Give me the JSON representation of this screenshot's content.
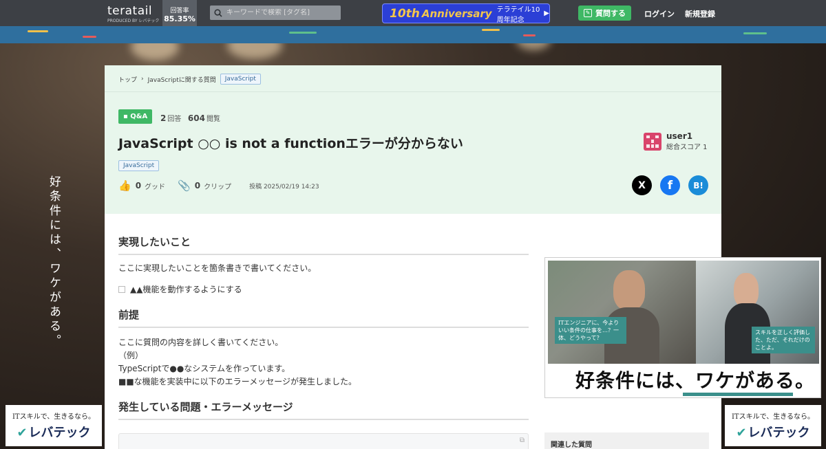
{
  "header": {
    "logo_name": "teratail",
    "logo_sub": "PRODUCED BY レバテック",
    "answer_rate_label": "回答率",
    "answer_rate_value": "85.35%",
    "search_placeholder": "キーワードで検索 [タグ名]",
    "anniversary_num": "10th",
    "anniversary_word": "Anniversary",
    "anniversary_jp": "テラテイル10周年記念",
    "ask_label": "質問する",
    "login_label": "ログイン",
    "signup_label": "新規登録",
    "bg_color": "#3d4045",
    "accent_green": "#3fb865"
  },
  "side_ads": {
    "copy": "好条件には、ワケがある。",
    "logo_line1": "ITスキルで、生きるなら。",
    "logo_line2": "レバテック"
  },
  "breadcrumb": {
    "top": "トップ",
    "category": "JavaScriptに関する質問",
    "tag": "JavaScript"
  },
  "question": {
    "badge": "Q&A",
    "answers_count": "2",
    "answers_label": "回答",
    "views_count": "604",
    "views_label": "閲覧",
    "title": "JavaScript ○○ is not a functionエラーが分からない",
    "tag": "JavaScript",
    "good_count": "0",
    "good_label": "グッド",
    "clip_count": "0",
    "clip_label": "クリップ",
    "posted": "投稿 2025/02/19 14:23"
  },
  "user": {
    "name": "user1",
    "score": "総合スコア 1"
  },
  "share": {
    "x_label": "X",
    "facebook_label": "f",
    "hatena_label": "B!"
  },
  "content": {
    "section1_title": "実現したいこと",
    "section1_text": "ここに実現したいことを箇条書きで書いてください。",
    "section1_check": "▲▲機能を動作するようにする",
    "section2_title": "前提",
    "section2_line1": "ここに質問の内容を詳しく書いてください。",
    "section2_line2": "（例）",
    "section2_line3": "TypeScriptで●●なシステムを作っています。",
    "section2_line4": "■■な機能を実装中に以下のエラーメッセージが発生しました。",
    "section3_title": "発生している問題・エラーメッセージ"
  },
  "ad": {
    "bubble1": "ITエンジニアに、今よりいい条件の仕事を…？一体、どうやって？",
    "bubble2": "スキルを正しく評価した、ただ、それだけのことよ。",
    "copy": "好条件には、ワケがある。"
  },
  "sidebar": {
    "related_title": "関連した質問"
  }
}
